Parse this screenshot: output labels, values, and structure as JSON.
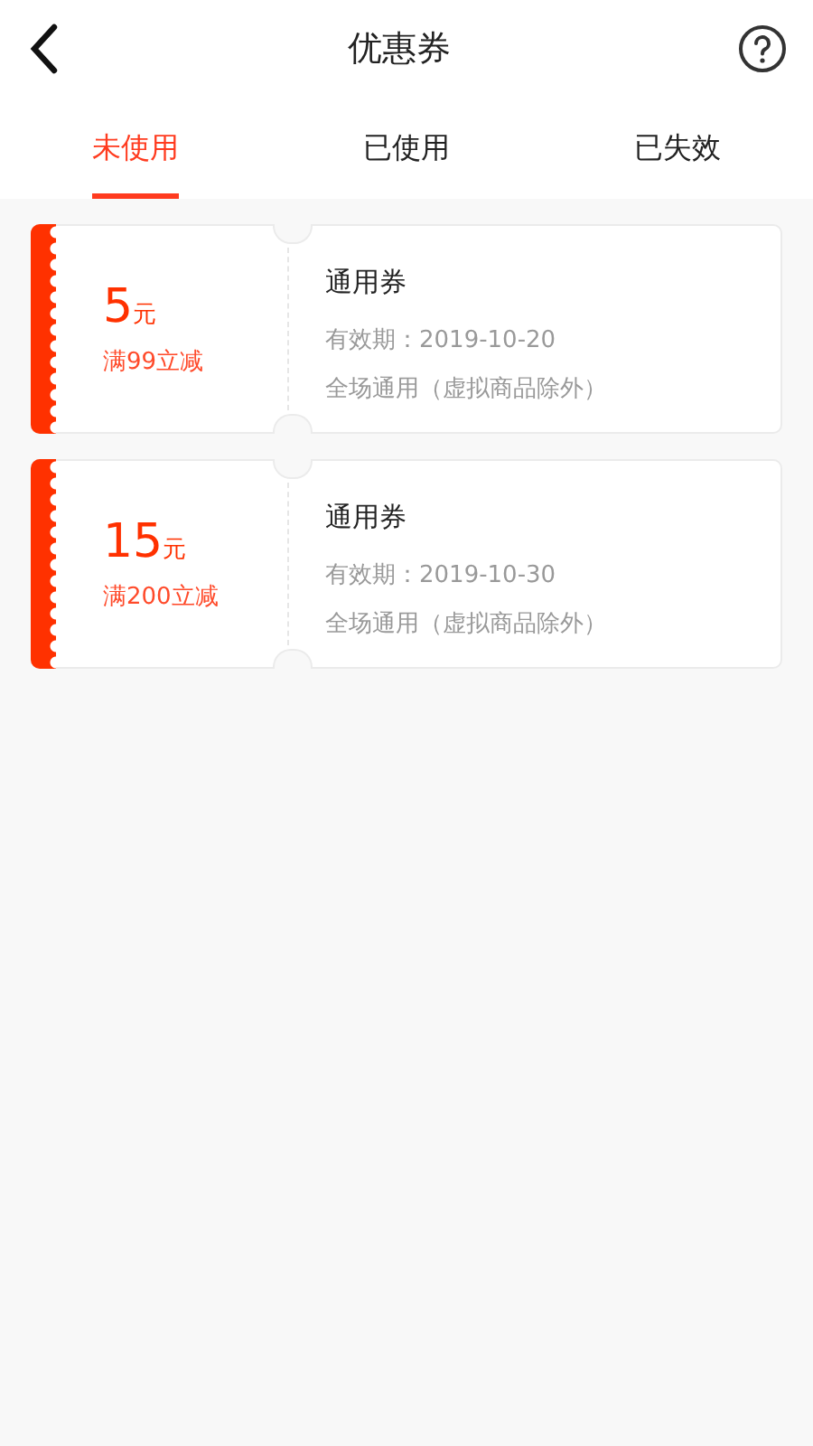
{
  "header": {
    "title": "优惠券"
  },
  "tabs": [
    {
      "label": "未使用",
      "selected": true
    },
    {
      "label": "已使用",
      "selected": false
    },
    {
      "label": "已失效",
      "selected": false
    }
  ],
  "coupons": [
    {
      "amount": "5",
      "unit": "元",
      "condition": "满99立减",
      "name": "通用券",
      "validity": "有效期：2019-10-20",
      "scope": "全场通用（虚拟商品除外）"
    },
    {
      "amount": "15",
      "unit": "元",
      "condition": "满200立减",
      "name": "通用券",
      "validity": "有效期：2019-10-30",
      "scope": "全场通用（虚拟商品除外）"
    }
  ]
}
